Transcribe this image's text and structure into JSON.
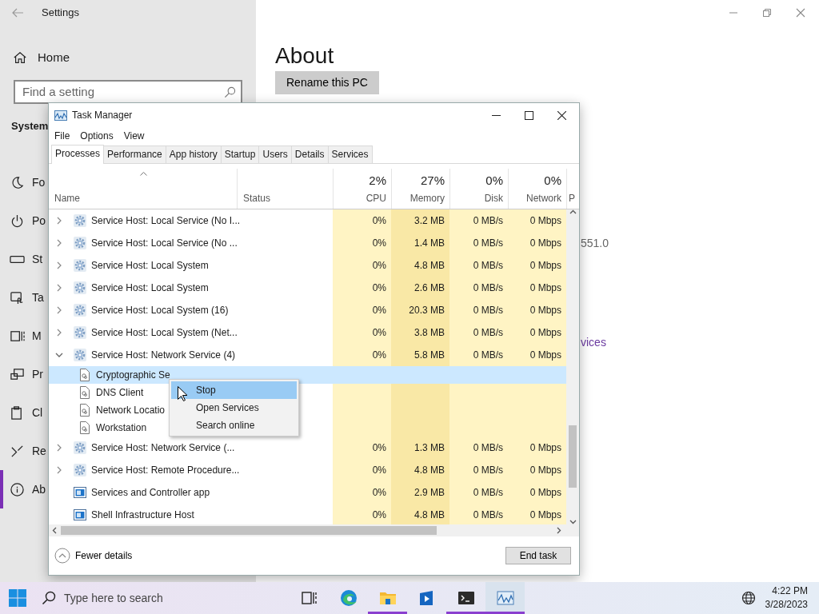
{
  "settings": {
    "title": "Settings",
    "home": "Home",
    "search": {
      "placeholder": "Find a setting"
    },
    "section": "System",
    "nav": [
      {
        "label": "Fo",
        "selected": false
      },
      {
        "label": "Po",
        "selected": false
      },
      {
        "label": "St",
        "selected": false
      },
      {
        "label": "Ta",
        "selected": false
      },
      {
        "label": "M",
        "selected": false
      },
      {
        "label": "Pr",
        "selected": false
      },
      {
        "label": "Cl",
        "selected": false
      },
      {
        "label": "Re",
        "selected": false
      },
      {
        "label": "Ab",
        "selected": true
      }
    ],
    "page_title": "About",
    "rename_button": "Rename this PC",
    "version_fragment": "551.0",
    "link_fragment": "vices"
  },
  "task_manager": {
    "title": "Task Manager",
    "menu": [
      "File",
      "Options",
      "View"
    ],
    "tabs": [
      {
        "label": "Processes",
        "selected": true
      },
      {
        "label": "Performance",
        "selected": false
      },
      {
        "label": "App history",
        "selected": false
      },
      {
        "label": "Startup",
        "selected": false
      },
      {
        "label": "Users",
        "selected": false
      },
      {
        "label": "Details",
        "selected": false
      },
      {
        "label": "Services",
        "selected": false
      }
    ],
    "columns": [
      {
        "label": "Name"
      },
      {
        "label": "Status"
      },
      {
        "usage": "2%",
        "label": "CPU"
      },
      {
        "usage": "27%",
        "label": "Memory"
      },
      {
        "usage": "0%",
        "label": "Disk"
      },
      {
        "usage": "0%",
        "label": "Network"
      },
      {
        "label": "P"
      }
    ],
    "rows": [
      {
        "kind": "group",
        "name": "Service Host: Local Service (No I...",
        "expanded": false,
        "selected": false,
        "cpu": "0%",
        "memory": "3.2 MB",
        "disk": "0 MB/s",
        "network": "0 Mbps"
      },
      {
        "kind": "group",
        "name": "Service Host: Local Service (No ...",
        "expanded": false,
        "selected": false,
        "cpu": "0%",
        "memory": "1.4 MB",
        "disk": "0 MB/s",
        "network": "0 Mbps"
      },
      {
        "kind": "group",
        "name": "Service Host: Local System",
        "expanded": false,
        "selected": false,
        "cpu": "0%",
        "memory": "4.8 MB",
        "disk": "0 MB/s",
        "network": "0 Mbps"
      },
      {
        "kind": "group",
        "name": "Service Host: Local System",
        "expanded": false,
        "selected": false,
        "cpu": "0%",
        "memory": "2.6 MB",
        "disk": "0 MB/s",
        "network": "0 Mbps"
      },
      {
        "kind": "group",
        "name": "Service Host: Local System (16)",
        "expanded": false,
        "selected": false,
        "cpu": "0%",
        "memory": "20.3 MB",
        "disk": "0 MB/s",
        "network": "0 Mbps"
      },
      {
        "kind": "group",
        "name": "Service Host: Local System (Net...",
        "expanded": false,
        "selected": false,
        "cpu": "0%",
        "memory": "3.8 MB",
        "disk": "0 MB/s",
        "network": "0 Mbps"
      },
      {
        "kind": "group",
        "name": "Service Host: Network Service (4)",
        "expanded": true,
        "selected": false,
        "cpu": "0%",
        "memory": "5.8 MB",
        "disk": "0 MB/s",
        "network": "0 Mbps",
        "children": [
          {
            "kind": "service",
            "name": "Cryptographic Se",
            "selected": true
          },
          {
            "kind": "service",
            "name": "DNS Client",
            "selected": false
          },
          {
            "kind": "service",
            "name": "Network Locatio",
            "selected": false
          },
          {
            "kind": "service",
            "name": "Workstation",
            "selected": false
          }
        ]
      },
      {
        "kind": "group",
        "name": "Service Host: Network Service (...",
        "expanded": false,
        "selected": false,
        "cpu": "0%",
        "memory": "1.3 MB",
        "disk": "0 MB/s",
        "network": "0 Mbps"
      },
      {
        "kind": "group",
        "name": "Service Host: Remote Procedure...",
        "expanded": false,
        "selected": false,
        "cpu": "0%",
        "memory": "4.8 MB",
        "disk": "0 MB/s",
        "network": "0 Mbps"
      },
      {
        "kind": "app",
        "name": "Services and Controller app",
        "selected": false,
        "cpu": "0%",
        "memory": "2.9 MB",
        "disk": "0 MB/s",
        "network": "0 Mbps"
      },
      {
        "kind": "app",
        "name": "Shell Infrastructure Host",
        "selected": false,
        "cpu": "0%",
        "memory": "4.8 MB",
        "disk": "0 MB/s",
        "network": "0 Mbps"
      }
    ],
    "fewer_details": "Fewer details",
    "end_task": "End task"
  },
  "context_menu": {
    "items": [
      {
        "label": "Stop",
        "selected": true
      },
      {
        "label": "Open Services",
        "selected": false
      },
      {
        "label": "Search online",
        "selected": false
      }
    ]
  },
  "taskbar": {
    "search": {
      "placeholder": "Type here to search"
    },
    "apps": [
      {
        "running": false,
        "selected": false
      },
      {
        "running": false,
        "selected": false
      },
      {
        "running": true,
        "selected": false
      },
      {
        "running": false,
        "selected": false
      },
      {
        "running": true,
        "selected": false
      },
      {
        "running": true,
        "selected": true
      }
    ],
    "time": "4:22 PM",
    "date": "3/28/2023"
  }
}
